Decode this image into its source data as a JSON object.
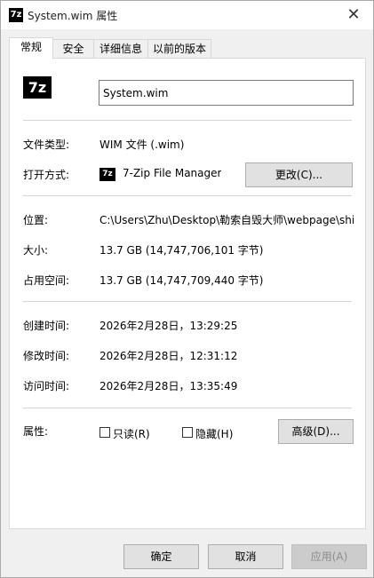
{
  "window": {
    "title": "System.wim 属性",
    "title_icon": "7z",
    "close_glyph": "✕"
  },
  "tabs": [
    {
      "label": "常规",
      "active": true
    },
    {
      "label": "安全"
    },
    {
      "label": "详细信息"
    },
    {
      "label": "以前的版本"
    }
  ],
  "general": {
    "big_icon": "7z",
    "filename": "System.wim",
    "file_type_label": "文件类型:",
    "file_type_value": "WIM 文件 (.wim)",
    "open_with_label": "打开方式:",
    "open_with_icon": "7z",
    "open_with_value": "7-Zip File Manager",
    "change_button": "更改(C)...",
    "location_label": "位置:",
    "location_value": "C:\\Users\\Zhu\\Desktop\\勒索自毁大师\\webpage\\shi",
    "size_label": "大小:",
    "size_value": "13.7 GB (14,747,706,101 字节)",
    "size_on_disk_label": "占用空间:",
    "size_on_disk_value": "13.7 GB (14,747,709,440 字节)",
    "created_label": "创建时间:",
    "created_value": "2026年2月28日，13:29:25",
    "modified_label": "修改时间:",
    "modified_value": "2026年2月28日，12:31:12",
    "accessed_label": "访问时间:",
    "accessed_value": "2026年2月28日，13:35:49",
    "attributes_label": "属性:",
    "readonly_label": "只读(R)",
    "hidden_label": "隐藏(H)",
    "advanced_button": "高级(D)..."
  },
  "footer": {
    "ok": "确定",
    "cancel": "取消",
    "apply": "应用(A)"
  }
}
